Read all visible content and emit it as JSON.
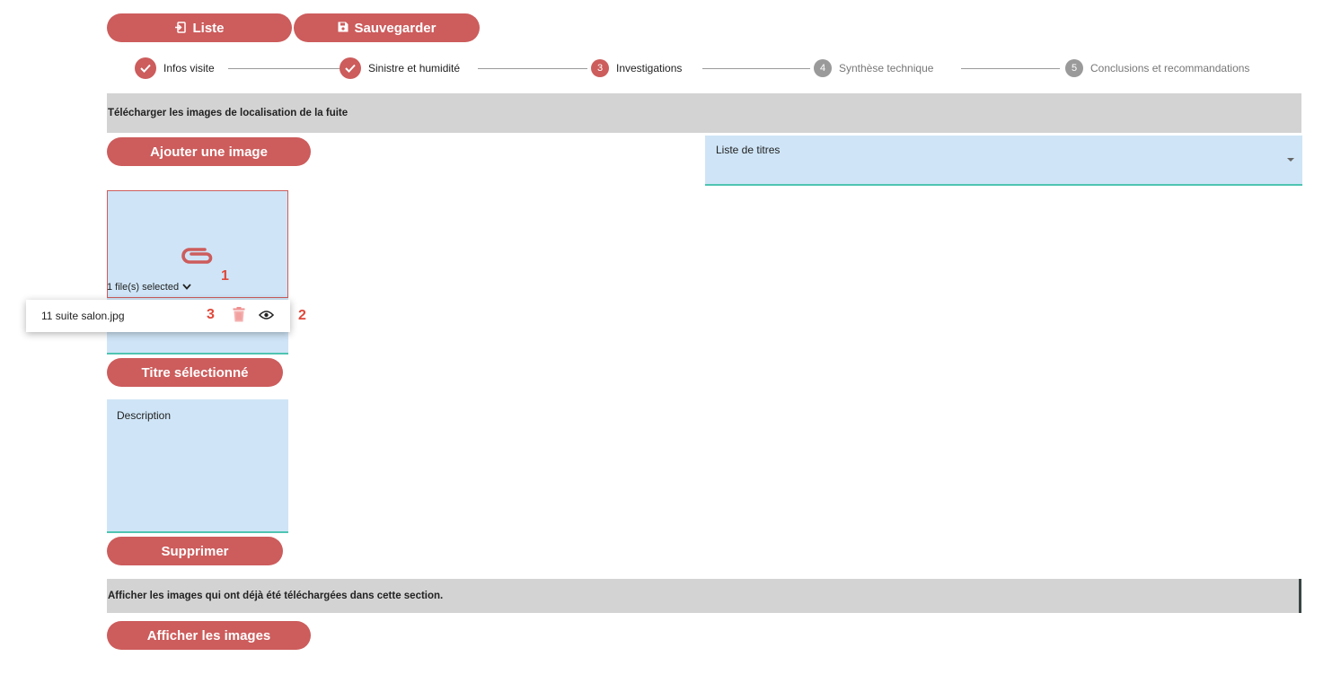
{
  "toolbar": {
    "list_label": "Liste",
    "list_icon": "sign-in-icon",
    "save_label": "Sauvegarder",
    "save_icon": "floppy-disk-icon"
  },
  "stepper": {
    "steps": [
      {
        "number": "1",
        "label": "Infos visite",
        "state": "done"
      },
      {
        "number": "2",
        "label": "Sinistre et humidité",
        "state": "done"
      },
      {
        "number": "3",
        "label": "Investigations",
        "state": "active"
      },
      {
        "number": "4",
        "label": "Synthèse technique",
        "state": "pending"
      },
      {
        "number": "5",
        "label": "Conclusions et recommandations",
        "state": "pending"
      }
    ]
  },
  "upload_section": {
    "title": "Télécharger les images de localisation de la fuite",
    "add_image_label": "Ajouter une image",
    "titles_select_placeholder": "Liste de titres",
    "file_count_text": "1 file(s) selected",
    "file_name": "11 suite salon.jpg",
    "selected_title_label": "Titre sélectionné",
    "description_placeholder": "Description",
    "delete_label": "Supprimer"
  },
  "annotations": {
    "marker_1": "1",
    "marker_2": "2",
    "marker_3": "3"
  },
  "gallery_section": {
    "title": "Afficher les images qui ont déjà été téléchargées dans cette section.",
    "show_images_label": "Afficher les images"
  },
  "colors": {
    "accent": "#cd5c5c",
    "field_bg": "#cfe5f7",
    "field_underline": "#4fc4b2",
    "section_bg": "#d3d3d3",
    "pending_step": "#9a9a9a",
    "annotation_marker": "#e0483a"
  }
}
